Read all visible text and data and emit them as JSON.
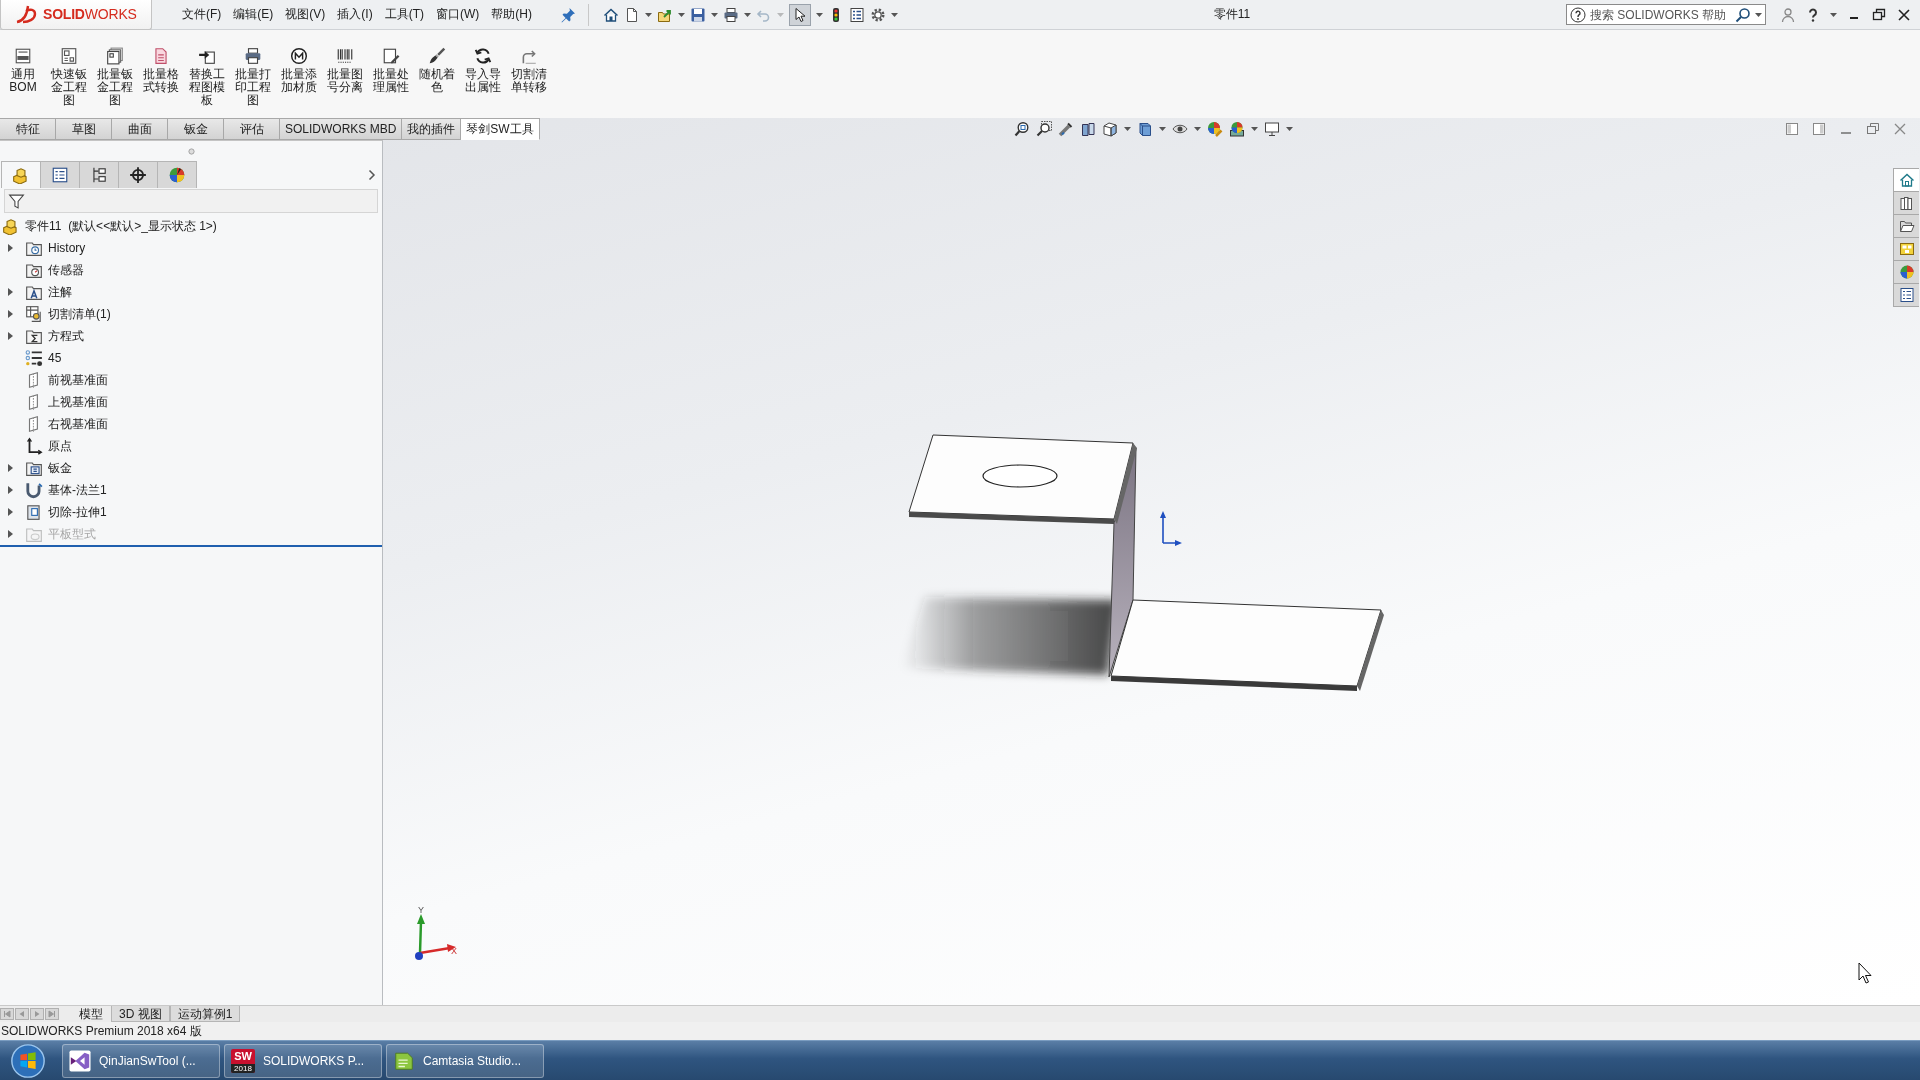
{
  "app": {
    "logo": "**SOLID**WORKS"
  },
  "menu": [
    "文件(F)",
    "编辑(E)",
    "视图(V)",
    "插入(I)",
    "工具(T)",
    "窗口(W)",
    "帮助(H)"
  ],
  "quick_access": {
    "select_active": true,
    "undo_disabled": true
  },
  "document_title": "零件11",
  "search": {
    "placeholder": "搜索 SOLIDWORKS 帮助"
  },
  "ribbon": [
    "通用BOM",
    "快速钣金工程图",
    "批量钣金工程图",
    "批量格式转换",
    "替换工程图模板",
    "批量打印工程图",
    "批量添加材质",
    "批量图号分离",
    "批量处理属性",
    "随机着色",
    "导入导出属性",
    "切割清单转移"
  ],
  "command_tabs": [
    {
      "label": "特征",
      "selected": false
    },
    {
      "label": "草图",
      "selected": false
    },
    {
      "label": "曲面",
      "selected": false
    },
    {
      "label": "钣金",
      "selected": false
    },
    {
      "label": "评估",
      "selected": false
    },
    {
      "label": "SOLIDWORKS MBD",
      "selected": false
    },
    {
      "label": "我的插件",
      "selected": false
    },
    {
      "label": "琴剑SW工具",
      "selected": true
    }
  ],
  "panel_tabs": [
    {
      "kind": "feature",
      "selected": true
    },
    {
      "kind": "property",
      "selected": false
    },
    {
      "kind": "configuration",
      "selected": false
    },
    {
      "kind": "dimxpert",
      "selected": false
    },
    {
      "kind": "display",
      "selected": false
    }
  ],
  "feature_tree": {
    "root": "零件11  (默认<<默认>_显示状态 1>)",
    "items": [
      {
        "label": "History",
        "expandable": true,
        "disabled": false
      },
      {
        "label": "传感器",
        "expandable": false,
        "disabled": false
      },
      {
        "label": "注解",
        "expandable": true,
        "disabled": false
      },
      {
        "label": "切割清单(1)",
        "expandable": true,
        "disabled": false
      },
      {
        "label": "方程式",
        "expandable": true,
        "disabled": false
      },
      {
        "label": "45",
        "expandable": false,
        "disabled": false
      },
      {
        "label": "前视基准面",
        "expandable": false,
        "disabled": false
      },
      {
        "label": "上视基准面",
        "expandable": false,
        "disabled": false
      },
      {
        "label": "右视基准面",
        "expandable": false,
        "disabled": false
      },
      {
        "label": "原点",
        "expandable": false,
        "disabled": false
      },
      {
        "label": "钣金",
        "expandable": true,
        "disabled": false
      },
      {
        "label": "基体-法兰1",
        "expandable": true,
        "disabled": false
      },
      {
        "label": "切除-拉伸1",
        "expandable": true,
        "disabled": false
      },
      {
        "label": "平板型式",
        "expandable": true,
        "disabled": true
      }
    ]
  },
  "task_pane_tabs": [
    {
      "kind": "resources",
      "selected": true
    },
    {
      "kind": "library",
      "selected": false
    },
    {
      "kind": "explorer",
      "selected": false
    },
    {
      "kind": "palette",
      "selected": false
    },
    {
      "kind": "appearance",
      "selected": false
    },
    {
      "kind": "properties",
      "selected": false
    }
  ],
  "triad": {
    "y": "Y",
    "x": "X"
  },
  "bottom_tabs": [
    {
      "label": "模型",
      "selected": true
    },
    {
      "label": "3D 视图",
      "selected": false
    },
    {
      "label": "运动算例1",
      "selected": false
    }
  ],
  "status_bar": "SOLIDWORKS Premium 2018 x64 版",
  "taskbar": [
    {
      "kind": "visual-studio",
      "label": "QinJianSwTool (..."
    },
    {
      "kind": "solidworks",
      "icon_text": "SW",
      "badge": "2018",
      "label": "SOLIDWORKS P..."
    },
    {
      "kind": "camtasia",
      "label": "Camtasia Studio..."
    }
  ]
}
